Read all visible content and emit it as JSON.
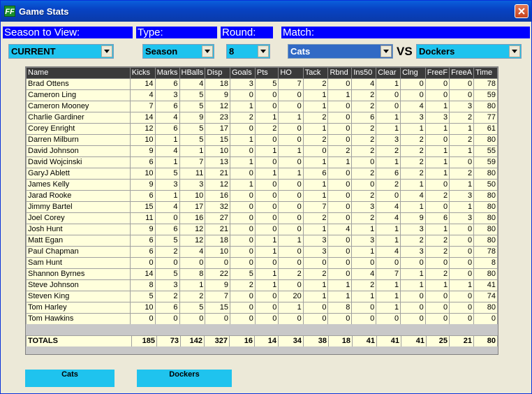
{
  "window": {
    "title": "Game Stats",
    "icon_text": "FF",
    "close_icon": "close-icon"
  },
  "filters": {
    "season_label": "Season to View:",
    "type_label": "Type:",
    "round_label": "Round:",
    "match_label": "Match:",
    "season_value": "CURRENT",
    "type_value": "Season",
    "round_value": "8",
    "home_team": "Cats",
    "vs_label": "VS",
    "away_team": "Dockers"
  },
  "table": {
    "columns": [
      "Name",
      "Kicks",
      "Marks",
      "HBalls",
      "Disp",
      "Goals",
      "Pts",
      "HO",
      "Tack",
      "Rbnd",
      "Ins50",
      "Clear",
      "Clng",
      "FreeF",
      "FreeA",
      "Time"
    ],
    "rows": [
      [
        "Brad Ottens",
        "14",
        "6",
        "4",
        "18",
        "3",
        "5",
        "7",
        "2",
        "0",
        "4",
        "1",
        "0",
        "0",
        "0",
        "78"
      ],
      [
        "Cameron Ling",
        "4",
        "3",
        "5",
        "9",
        "0",
        "0",
        "0",
        "1",
        "1",
        "2",
        "0",
        "0",
        "0",
        "0",
        "59"
      ],
      [
        "Cameron Mooney",
        "7",
        "6",
        "5",
        "12",
        "1",
        "0",
        "0",
        "1",
        "0",
        "2",
        "0",
        "4",
        "1",
        "3",
        "80"
      ],
      [
        "Charlie Gardiner",
        "14",
        "4",
        "9",
        "23",
        "2",
        "1",
        "1",
        "2",
        "0",
        "6",
        "1",
        "3",
        "3",
        "2",
        "77"
      ],
      [
        "Corey Enright",
        "12",
        "6",
        "5",
        "17",
        "0",
        "2",
        "0",
        "1",
        "0",
        "2",
        "1",
        "1",
        "1",
        "1",
        "61"
      ],
      [
        "Darren Milburn",
        "10",
        "1",
        "5",
        "15",
        "1",
        "0",
        "0",
        "2",
        "0",
        "2",
        "3",
        "2",
        "0",
        "2",
        "80"
      ],
      [
        "David Johnson",
        "9",
        "4",
        "1",
        "10",
        "0",
        "1",
        "1",
        "0",
        "2",
        "2",
        "2",
        "2",
        "1",
        "1",
        "55"
      ],
      [
        "David Wojcinski",
        "6",
        "1",
        "7",
        "13",
        "1",
        "0",
        "0",
        "1",
        "1",
        "0",
        "1",
        "2",
        "1",
        "0",
        "59"
      ],
      [
        "GaryJ Ablett",
        "10",
        "5",
        "11",
        "21",
        "0",
        "1",
        "1",
        "6",
        "0",
        "2",
        "6",
        "2",
        "1",
        "2",
        "80"
      ],
      [
        "James Kelly",
        "9",
        "3",
        "3",
        "12",
        "1",
        "0",
        "0",
        "1",
        "0",
        "0",
        "2",
        "1",
        "0",
        "1",
        "50"
      ],
      [
        "Jarad Rooke",
        "6",
        "1",
        "10",
        "16",
        "0",
        "0",
        "0",
        "1",
        "0",
        "2",
        "0",
        "4",
        "2",
        "3",
        "80"
      ],
      [
        "Jimmy Bartel",
        "15",
        "4",
        "17",
        "32",
        "0",
        "0",
        "0",
        "7",
        "0",
        "3",
        "4",
        "1",
        "0",
        "1",
        "80"
      ],
      [
        "Joel Corey",
        "11",
        "0",
        "16",
        "27",
        "0",
        "0",
        "0",
        "2",
        "0",
        "2",
        "4",
        "9",
        "6",
        "3",
        "80"
      ],
      [
        "Josh Hunt",
        "9",
        "6",
        "12",
        "21",
        "0",
        "0",
        "0",
        "1",
        "4",
        "1",
        "1",
        "3",
        "1",
        "0",
        "80"
      ],
      [
        "Matt Egan",
        "6",
        "5",
        "12",
        "18",
        "0",
        "1",
        "1",
        "3",
        "0",
        "3",
        "1",
        "2",
        "2",
        "0",
        "80"
      ],
      [
        "Paul Chapman",
        "6",
        "2",
        "4",
        "10",
        "0",
        "1",
        "0",
        "3",
        "0",
        "1",
        "4",
        "3",
        "2",
        "0",
        "78"
      ],
      [
        "Sam Hunt",
        "0",
        "0",
        "0",
        "0",
        "0",
        "0",
        "0",
        "0",
        "0",
        "0",
        "0",
        "0",
        "0",
        "0",
        "8"
      ],
      [
        "Shannon Byrnes",
        "14",
        "5",
        "8",
        "22",
        "5",
        "1",
        "2",
        "2",
        "0",
        "4",
        "7",
        "1",
        "2",
        "0",
        "80"
      ],
      [
        "Steve Johnson",
        "8",
        "3",
        "1",
        "9",
        "2",
        "1",
        "0",
        "1",
        "1",
        "2",
        "1",
        "1",
        "1",
        "1",
        "41"
      ],
      [
        "Steven King",
        "5",
        "2",
        "2",
        "7",
        "0",
        "0",
        "20",
        "1",
        "1",
        "1",
        "1",
        "0",
        "0",
        "0",
        "74"
      ],
      [
        "Tom Harley",
        "10",
        "6",
        "5",
        "15",
        "0",
        "0",
        "1",
        "0",
        "8",
        "0",
        "1",
        "0",
        "0",
        "0",
        "80"
      ],
      [
        "Tom Hawkins",
        "0",
        "0",
        "0",
        "0",
        "0",
        "0",
        "0",
        "0",
        "0",
        "0",
        "0",
        "0",
        "0",
        "0",
        "0"
      ]
    ],
    "totals": [
      "TOTALS",
      "185",
      "73",
      "142",
      "327",
      "16",
      "14",
      "34",
      "38",
      "18",
      "41",
      "41",
      "41",
      "25",
      "21",
      "80"
    ]
  },
  "buttons": {
    "home_team_button": "Cats",
    "away_team_button": "Dockers"
  },
  "colors": {
    "header_bar": "#0000ff",
    "combo_fill": "#1fc3ee",
    "cell_fill": "#ffffdc",
    "column_header": "#3a3a3a"
  }
}
